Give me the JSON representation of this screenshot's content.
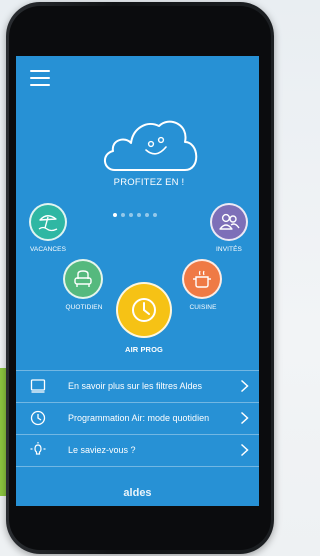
{
  "header": {
    "menu_icon": "hamburger-menu-icon"
  },
  "hero": {
    "label": "PROFITEZ EN !",
    "carousel_dots": 6,
    "active_dot": 0
  },
  "modes": {
    "vacances": {
      "label": "VACANCES",
      "color": "#2fb7a3",
      "icon": "beach-umbrella-icon"
    },
    "invites": {
      "label": "INVITÉS",
      "color": "#7d6fb8",
      "icon": "guests-icon"
    },
    "quotidien": {
      "label": "QUOTIDIEN",
      "color": "#55b97e",
      "icon": "armchair-icon"
    },
    "cuisine": {
      "label": "CUISINE",
      "color": "#ef7a45",
      "icon": "cooking-pot-icon"
    },
    "air_prog": {
      "label": "AIR PROG",
      "color": "#f6c215",
      "icon": "clock-icon"
    }
  },
  "menu": [
    {
      "label": "En savoir plus sur les filtres Aldes",
      "icon": "filter-icon"
    },
    {
      "label": "Programmation Air: mode quotidien",
      "icon": "clock-icon"
    },
    {
      "label": "Le saviez-vous ?",
      "icon": "lightbulb-icon"
    }
  ],
  "brand": "aldes"
}
